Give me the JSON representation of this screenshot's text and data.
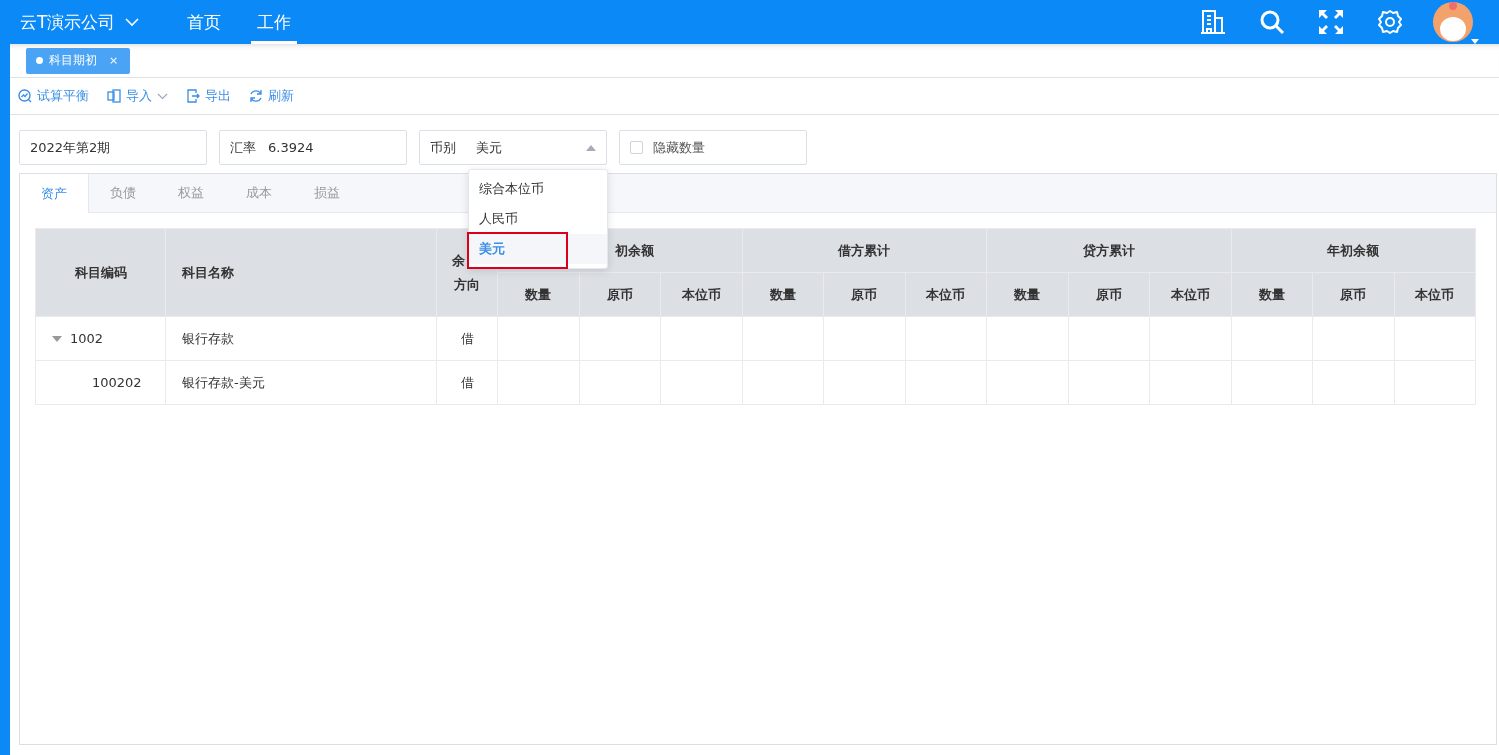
{
  "header": {
    "company": "云T演示公司",
    "nav": [
      {
        "label": "首页",
        "selected": false
      },
      {
        "label": "工作",
        "selected": true
      }
    ]
  },
  "page_tabs": [
    {
      "label": "科目期初",
      "selected": true,
      "close": "×"
    }
  ],
  "toolbar": [
    {
      "label": "试算平衡",
      "kind": "balance",
      "dropdown": false
    },
    {
      "label": "导入",
      "kind": "import",
      "dropdown": true
    },
    {
      "label": "导出",
      "kind": "export",
      "dropdown": false
    },
    {
      "label": "刷新",
      "kind": "refresh",
      "dropdown": false
    }
  ],
  "filters": {
    "period": "2022年第2期",
    "rate_label": "汇率",
    "rate": "6.3924",
    "currency_label": "币别",
    "currency": "美元",
    "expanded": true,
    "hide_qty": {
      "label": "隐藏数量",
      "checked": false
    }
  },
  "currency_menu": [
    {
      "label": "综合本位币",
      "selected": false
    },
    {
      "label": "人民币",
      "selected": false
    },
    {
      "label": "美元",
      "selected": true
    }
  ],
  "category_tabs": [
    {
      "label": "资产",
      "selected": true
    },
    {
      "label": "负债",
      "selected": false
    },
    {
      "label": "权益",
      "selected": false
    },
    {
      "label": "成本",
      "selected": false
    },
    {
      "label": "损益",
      "selected": false
    }
  ],
  "table": {
    "columns": [
      "科目编码",
      "科目名称"
    ],
    "direction_header": [
      "余",
      "方向"
    ],
    "groups": [
      {
        "label": "初余额",
        "subs": [
          "数量",
          "原币",
          "本位币"
        ]
      },
      {
        "label": "借方累计",
        "subs": [
          "数量",
          "原币",
          "本位币"
        ]
      },
      {
        "label": "贷方累计",
        "subs": [
          "数量",
          "原币",
          "本位币"
        ]
      },
      {
        "label": "年初余额",
        "subs": [
          "数量",
          "原币",
          "本位币"
        ]
      }
    ],
    "rows": [
      {
        "code": "1002",
        "name": "银行存款",
        "direction": "借",
        "expanded": true,
        "children": [
          {
            "code": "100202",
            "name": "银行存款-美元",
            "direction": "借"
          }
        ]
      }
    ]
  }
}
